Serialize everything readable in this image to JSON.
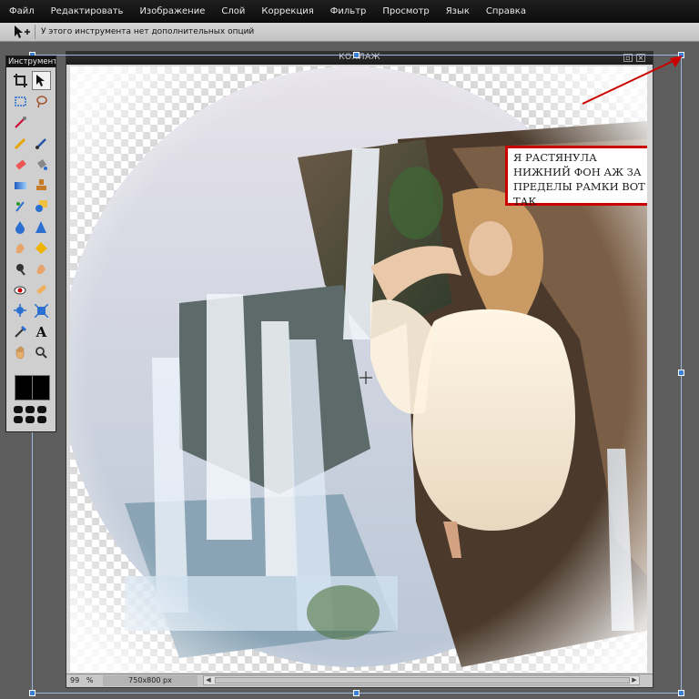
{
  "menu": [
    "Файл",
    "Редактировать",
    "Изображение",
    "Слой",
    "Коррекция",
    "Фильтр",
    "Просмотр",
    "Язык",
    "Справка"
  ],
  "options_bar": {
    "tool_icon": "move-tool-icon",
    "hint": "У этого инструмента нет дополнительных опций"
  },
  "document": {
    "title": "КОЛЛАЖ",
    "zoom": "99",
    "zoom_unit": "%",
    "size": "750x800 px",
    "buttons": [
      "maximize-icon",
      "close-icon"
    ]
  },
  "annotation": {
    "text": "Я РАСТЯНУЛА НИЖНИЙ ФОН АЖ ЗА ПРЕДЕЛЫ РАМКИ ВОТ ТАК",
    "color": "#cc0000"
  },
  "tools_palette": {
    "title": "Инструменты",
    "tools": [
      "crop-icon",
      "move-icon",
      "marquee-icon",
      "lasso-icon",
      "wand-icon",
      "",
      "pencil-icon",
      "brush-icon",
      "eraser-icon",
      "bucket-icon",
      "gradient-icon",
      "stamp-icon",
      "color-replace-icon",
      "shape-icon",
      "drop-icon",
      "sharpen-icon",
      "smudge-icon",
      "sponge-icon",
      "burn-icon",
      "dodge-icon",
      "red-eye-icon",
      "spot-heal-icon",
      "bloat-icon",
      "pinch-icon",
      "eyedropper-icon",
      "text-icon",
      "hand-icon",
      "zoom-icon"
    ],
    "foreground_color": "#000000",
    "background_color": "#000000"
  }
}
